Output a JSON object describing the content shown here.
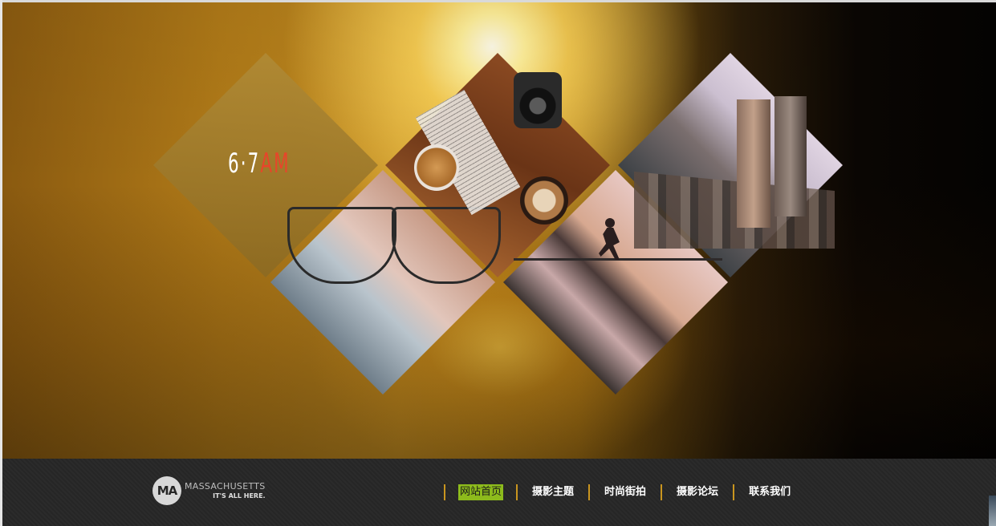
{
  "hero": {
    "title_main": "6·7",
    "title_accent": "AM",
    "tiles": [
      "title",
      "glasses",
      "cafe",
      "runner",
      "city"
    ]
  },
  "footer": {
    "logo": {
      "mark": "MA",
      "name": "MASSACHUSETTS",
      "tagline": "IT'S ALL HERE."
    },
    "nav": [
      {
        "label": "网站首页",
        "active": true
      },
      {
        "label": "摄影主题",
        "active": false
      },
      {
        "label": "时尚街拍",
        "active": false
      },
      {
        "label": "摄影论坛",
        "active": false
      },
      {
        "label": "联系我们",
        "active": false
      }
    ]
  },
  "colors": {
    "accent": "#8dbb1c",
    "separator": "#c9951f",
    "title_accent": "#e8452a"
  }
}
